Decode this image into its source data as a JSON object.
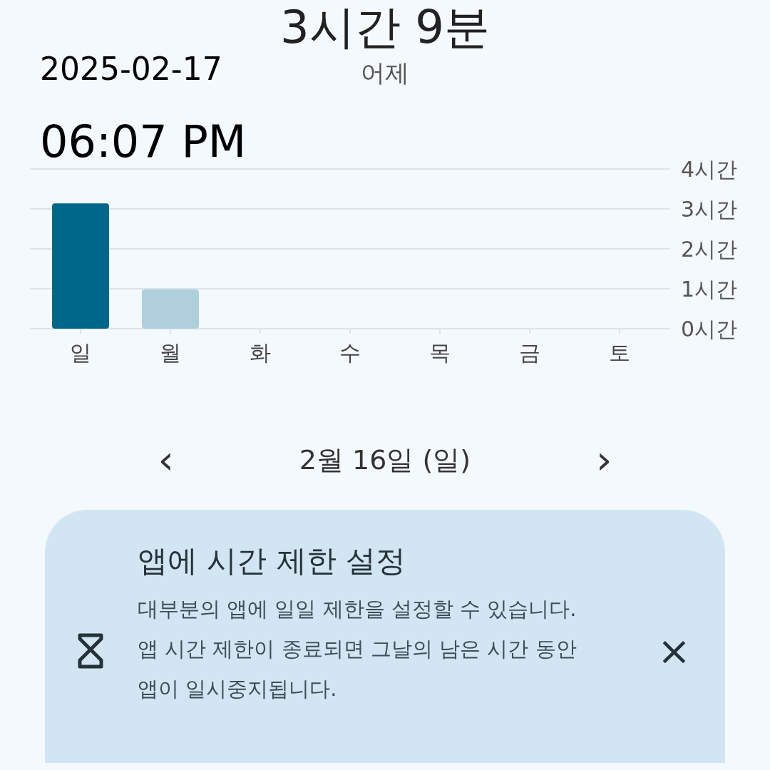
{
  "overlay": {
    "date": "2025-02-17",
    "time": "06:07 PM"
  },
  "summary": {
    "total": "3시간 9분",
    "day_label": "어제"
  },
  "usage_chart": {
    "chart_data": {
      "type": "bar",
      "categories": [
        "일",
        "월",
        "화",
        "수",
        "목",
        "금",
        "토"
      ],
      "series": [
        {
          "color": "#00668a",
          "values": [
            3.14,
            null,
            null,
            null,
            null,
            null,
            null
          ]
        },
        {
          "color": "#aecfdb",
          "values": [
            null,
            0.98,
            null,
            null,
            null,
            null,
            null
          ]
        }
      ],
      "stacked": true,
      "ylim": [
        0,
        4
      ],
      "grid": true,
      "yticks": [
        {
          "value": 0,
          "label": "0시간"
        },
        {
          "value": 1,
          "label": "1시간"
        },
        {
          "value": 2,
          "label": "2시간"
        },
        {
          "value": 3,
          "label": "3시간"
        },
        {
          "value": 4,
          "label": "4시간"
        }
      ]
    }
  },
  "date_nav": {
    "prev": "‹",
    "label": "2월 16일 (일)",
    "next": "›"
  },
  "tip_card": {
    "title": "앱에 시간 제한 설정",
    "body": "대부분의 앱에 일일 제한을 설정할 수 있습니다. 앱 시간 제한이 종료되면 그날의 남은 시간 동안 앱이 일시중지됩니다.",
    "close": "×"
  }
}
